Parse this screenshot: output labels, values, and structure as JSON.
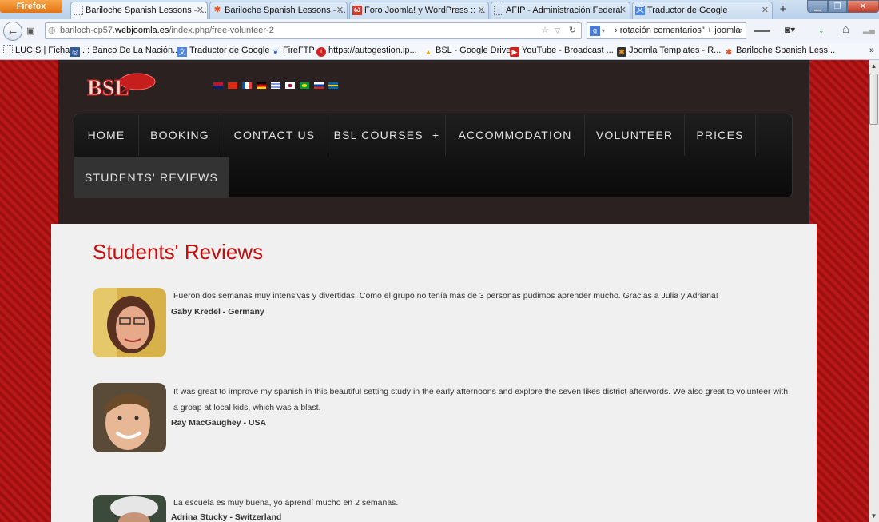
{
  "browser": {
    "menu_label": "Firefox",
    "tabs": [
      {
        "title": "Bariloche Spanish Lessons - ...",
        "active": true
      },
      {
        "title": "Bariloche Spanish Lessons - ..."
      },
      {
        "title": "Foro Joomla! y WordPress :: ..."
      },
      {
        "title": "AFIP - Administración Federal"
      },
      {
        "title": "Traductor de Google"
      }
    ],
    "new_tab": "+",
    "url_prefix": "bariloch-cp57.",
    "url_domain": "webjoomla.es",
    "url_path": "/index.php/free-volunteer-2",
    "search_query": "› rotación comentarios\" + joomla",
    "bookmarks": [
      "LUCIS | Fichas",
      ".:: Banco De La Nación...",
      "Traductor de Google",
      "FireFTP",
      "https://autogestion.ip...",
      "BSL - Google Drive",
      "YouTube - Broadcast ...",
      "Joomla Templates - R...",
      "Bariloche Spanish Less..."
    ],
    "bookmarks_more": "»"
  },
  "site": {
    "logo_text": "BSL",
    "menu": [
      "HOME",
      "BOOKING",
      "CONTACT US",
      "BSL COURSES",
      "ACCOMMODATION",
      "VOLUNTEER",
      "PRICES",
      "STUDENTS' REVIEWS"
    ],
    "menu_expand_glyph": "+"
  },
  "content": {
    "title": "Students' Reviews",
    "reviews": [
      {
        "quote": "Fueron dos semanas muy intensivas y divertidas. Como el grupo no tenía más de 3 personas pudimos aprender mucho. Gracias a Julia y Adriana!",
        "author": "Gaby Kredel - Germany"
      },
      {
        "quote": "It was great to improve my spanish in this beautiful setting study in the early afternoons and explore the seven likes district afterwords. We also great to volunteer with a groap at local kids, which was a blast.",
        "author": "Ray MacGaughey - USA"
      },
      {
        "quote": "La escuela es muy buena, yo aprendí mucho en 2 semanas.",
        "author": "Adrina Stucky - Switzerland"
      }
    ]
  },
  "colors": {
    "accent": "#c40c0c",
    "header_bg": "#2b2120",
    "content_bg": "#f0f0f0"
  }
}
